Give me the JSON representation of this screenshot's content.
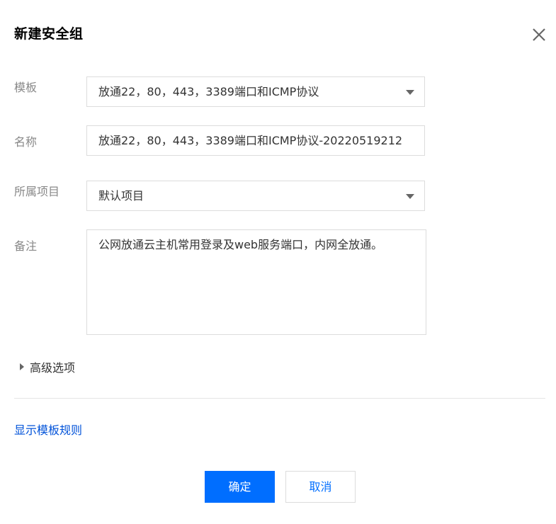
{
  "dialog": {
    "title": "新建安全组",
    "close_icon": "close-icon"
  },
  "form": {
    "template": {
      "label": "模板",
      "value": "放通22，80，443，3389端口和ICMP协议"
    },
    "name": {
      "label": "名称",
      "value": "放通22，80，443，3389端口和ICMP协议-20220519212"
    },
    "project": {
      "label": "所属项目",
      "value": "默认项目"
    },
    "remark": {
      "label": "备注",
      "value": "公网放通云主机常用登录及web服务端口，内网全放通。"
    }
  },
  "advanced": {
    "label": "高级选项",
    "icon": "caret-right-icon"
  },
  "show_rules_link": "显示模板规则",
  "buttons": {
    "confirm": "确定",
    "cancel": "取消"
  },
  "colors": {
    "primary": "#006eff",
    "link": "#0052d9",
    "label": "#888888",
    "border": "#dcdcdc"
  }
}
